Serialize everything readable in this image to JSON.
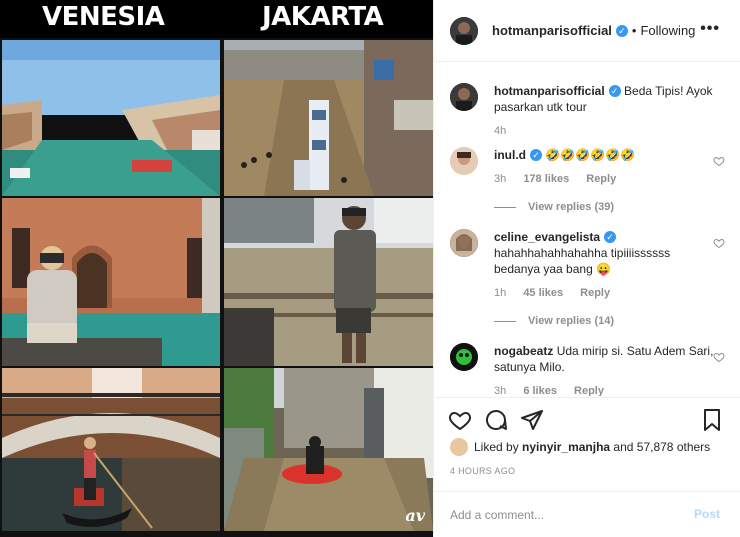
{
  "media": {
    "left_title": "VENESIA",
    "right_title": "JAKARTA",
    "watermark": "av"
  },
  "post": {
    "username": "hotmanparisofficial",
    "following": "Following",
    "more": "•••"
  },
  "caption": {
    "username": "hotmanparisofficial",
    "text": "Beda Tipis! Ayok pasarkan utk tour",
    "time": "4h"
  },
  "comments": [
    {
      "username": "inul.d",
      "text": "🤣🤣🤣🤣🤣🤣",
      "time": "3h",
      "likes": "178 likes",
      "reply": "Reply",
      "view_replies": "View replies (39)"
    },
    {
      "username": "celine_evangelista",
      "text": "hahahhahahhahahha tipiiiissssss bedanya yaa bang 😛",
      "time": "1h",
      "likes": "45 likes",
      "reply": "Reply",
      "view_replies": "View replies (14)"
    },
    {
      "username": "nogabeatz",
      "text": "Uda mirip si. Satu Adem Sari, satunya Milo.",
      "time": "3h",
      "likes": "6 likes",
      "reply": "Reply"
    }
  ],
  "likes": {
    "prefix": "Liked by",
    "user": "nyinyir_manjha",
    "suffix": "and 57,878 others"
  },
  "timestamp": "4 HOURS AGO",
  "add_comment": {
    "placeholder": "Add a comment...",
    "post_label": "Post"
  },
  "colors": {
    "verified": "#3897f0",
    "post_button": "#b3dbff",
    "muted": "#8e8e8e"
  },
  "icons": [
    "heart-icon",
    "comment-icon",
    "share-icon",
    "bookmark-icon",
    "more-icon",
    "verified-icon"
  ]
}
